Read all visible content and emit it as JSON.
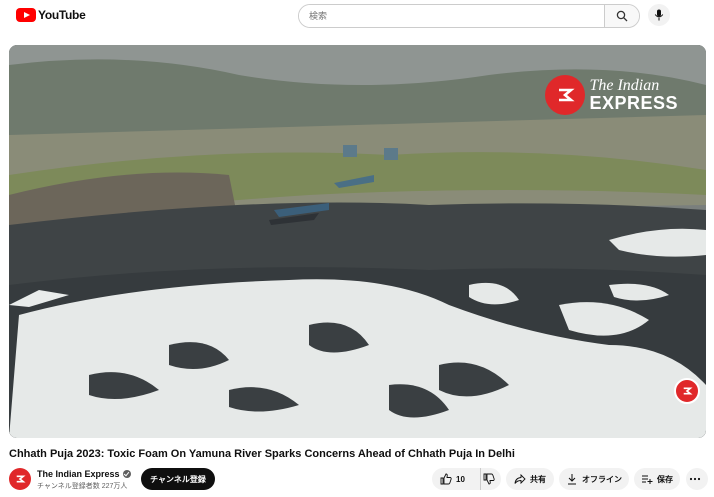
{
  "header": {
    "logo_text": "YouTube",
    "search_placeholder": "検索",
    "icons": [
      "search-icon",
      "mic-icon"
    ]
  },
  "video": {
    "brand_line1": "The Indian",
    "brand_line2": "EXPRESS"
  },
  "title": "Chhath Puja 2023: Toxic Foam On Yamuna River Sparks Concerns Ahead of Chhath Puja In Delhi",
  "channel": {
    "name": "The Indian Express",
    "subscribers": "チャンネル登録者数 227万人",
    "subscribe_label": "チャンネル登録"
  },
  "actions": {
    "like_count": "10",
    "share_label": "共有",
    "offline_label": "オフライン",
    "save_label": "保存"
  },
  "colors": {
    "brand_red": "#e0282a",
    "youtube_red": "#ff0000"
  }
}
